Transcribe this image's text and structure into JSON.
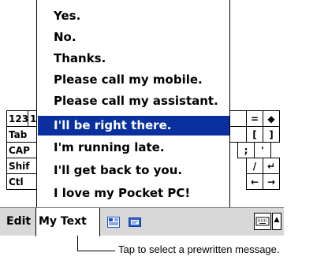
{
  "popup_menu": {
    "items": [
      {
        "label": "Yes."
      },
      {
        "label": "No."
      },
      {
        "label": "Thanks."
      },
      {
        "label": "Please call my mobile."
      },
      {
        "label": "Please call my assistant."
      },
      {
        "label": "I'll be right there.",
        "selected": true
      },
      {
        "label": "I'm running late."
      },
      {
        "label": "I'll get back to you."
      },
      {
        "label": "I love my Pocket PC!"
      }
    ]
  },
  "keyboard": {
    "left_keys": [
      "123",
      "Tab",
      "CAP",
      "Shif",
      "Ctl"
    ],
    "left_partial": [
      "1",
      "",
      "",
      "",
      ""
    ],
    "right_keys": {
      "row1": [
        "=",
        "◆"
      ],
      "row2": [
        "[",
        "]"
      ],
      "row3": [
        ";",
        "'"
      ],
      "row4": [
        "/",
        "↵"
      ],
      "row5": [
        "←",
        "→"
      ]
    }
  },
  "toolbar": {
    "edit_label": "Edit",
    "mytext_label": "My Text",
    "icons": [
      "notes-icon",
      "message-icon"
    ],
    "sip_icon": "keyboard-icon",
    "sip_arrow": "▲"
  },
  "callout": {
    "text": "Tap to select a prewritten message."
  },
  "colors": {
    "selection": "#0a2f9e",
    "toolbar": "#d8d8d8"
  }
}
